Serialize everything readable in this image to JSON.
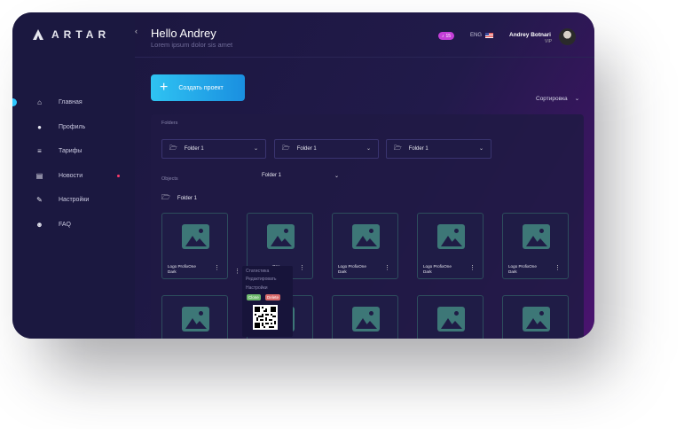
{
  "brand": {
    "name": "ARTAR"
  },
  "sidebar": {
    "items": [
      {
        "label": "Главная",
        "icon": "home-icon"
      },
      {
        "label": "Профиль",
        "icon": "profile-icon"
      },
      {
        "label": "Тарифы",
        "icon": "tariffs-icon"
      },
      {
        "label": "Новости",
        "icon": "news-icon"
      },
      {
        "label": "Настройки",
        "icon": "settings-icon"
      },
      {
        "label": "FAQ",
        "icon": "faq-icon"
      }
    ]
  },
  "header": {
    "greeting": "Hello Andrey",
    "subtitle": "Lorem ipsum dolor sis amet",
    "notifications": "15",
    "language": "ENG",
    "user_name": "Andrey Botnari",
    "user_role": "VIP"
  },
  "actions": {
    "create_label": "Создать проект",
    "sort_label": "Сортировка"
  },
  "folders": {
    "label": "Folders",
    "items": [
      "Folder 1",
      "Folder 1",
      "Folder 1"
    ],
    "extra_dropdown": "Folder 1"
  },
  "objects": {
    "label": "Objects",
    "folder_title": "Folder 1"
  },
  "cards": [
    {
      "line1": "Logo ProfixOne",
      "line2": "Dark"
    },
    {
      "line1": "",
      "line2": ""
    },
    {
      "line1": "Logo ProfixOne",
      "line2": "Dark"
    },
    {
      "line1": "Logo ProfixOne",
      "line2": "Dark"
    },
    {
      "line1": "Logo ProfixOne",
      "line2": "Dark"
    }
  ],
  "context_menu": {
    "items": [
      "Статистика",
      "Редактировать",
      "Настройки"
    ],
    "clone": "Clone",
    "delete": "Delete",
    "partial_text_1": "One",
    "partial_text_2": "Dark"
  },
  "colors": {
    "accent": "#2ec8ff",
    "create_button": "#1fa8e8",
    "notification": "#c43fd8",
    "clone": "#6db86d",
    "delete": "#d86a6a",
    "image_placeholder": "#3d7777"
  }
}
